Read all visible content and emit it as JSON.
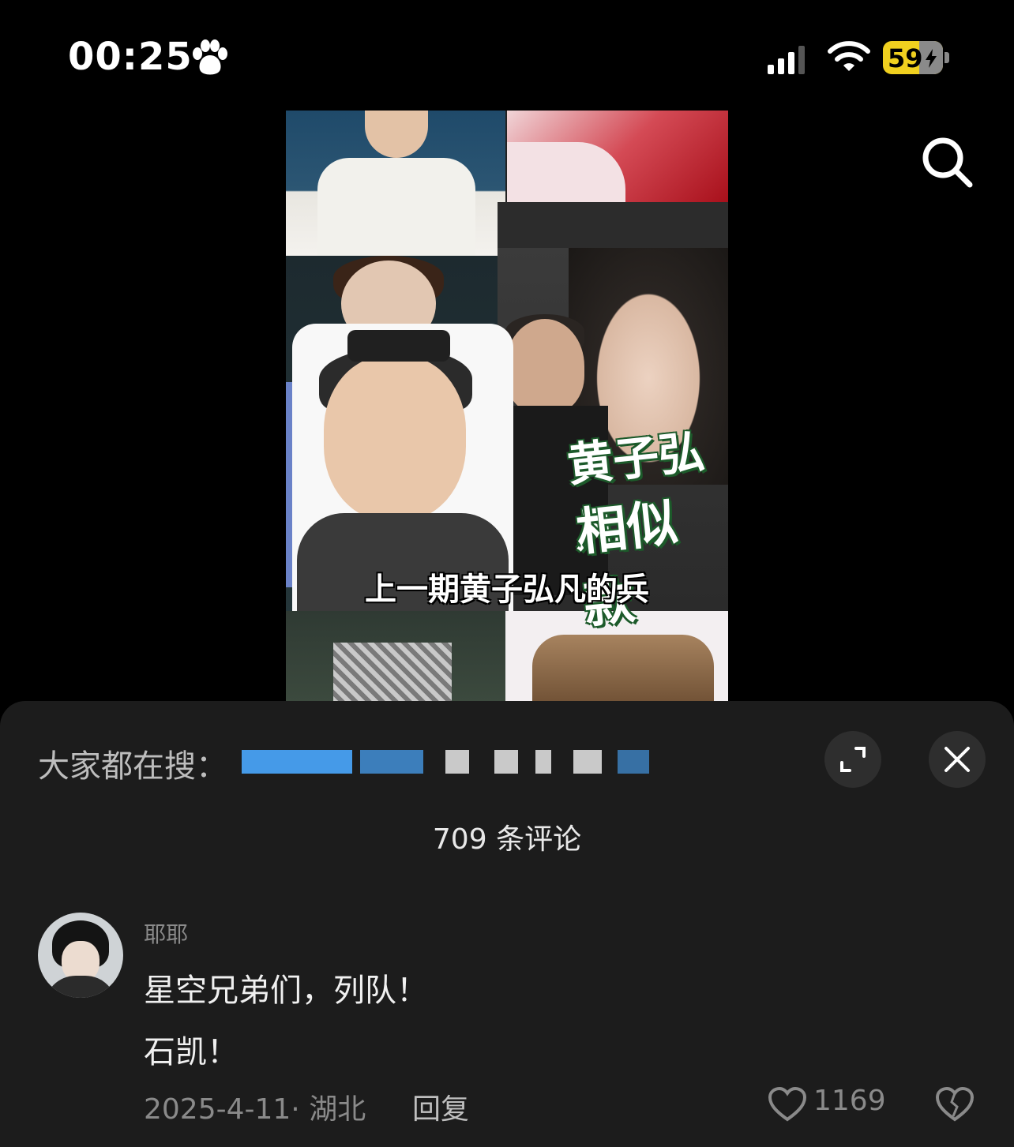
{
  "status": {
    "time": "00:25",
    "battery": "59"
  },
  "video": {
    "overlay_title_line1": "黄子弘凡",
    "overlay_title_line2": "相似款",
    "caption": "上一期黄子弘凡的兵"
  },
  "sheet": {
    "trending_label": "大家都在搜：",
    "comment_count": "709 条评论"
  },
  "comment": {
    "username": "耶耶",
    "line1": "星空兄弟们，列队！",
    "line2": "石凯！",
    "meta": "2025-4-11· 湖北",
    "reply_label": "回复",
    "like_count": "1169"
  },
  "icons": {
    "status": [
      "paw-icon",
      "signal-icon",
      "wifi-icon",
      "battery-icon"
    ],
    "actions": [
      "search-icon",
      "expand-icon",
      "close-icon",
      "heart-icon",
      "dislike-icon"
    ]
  }
}
